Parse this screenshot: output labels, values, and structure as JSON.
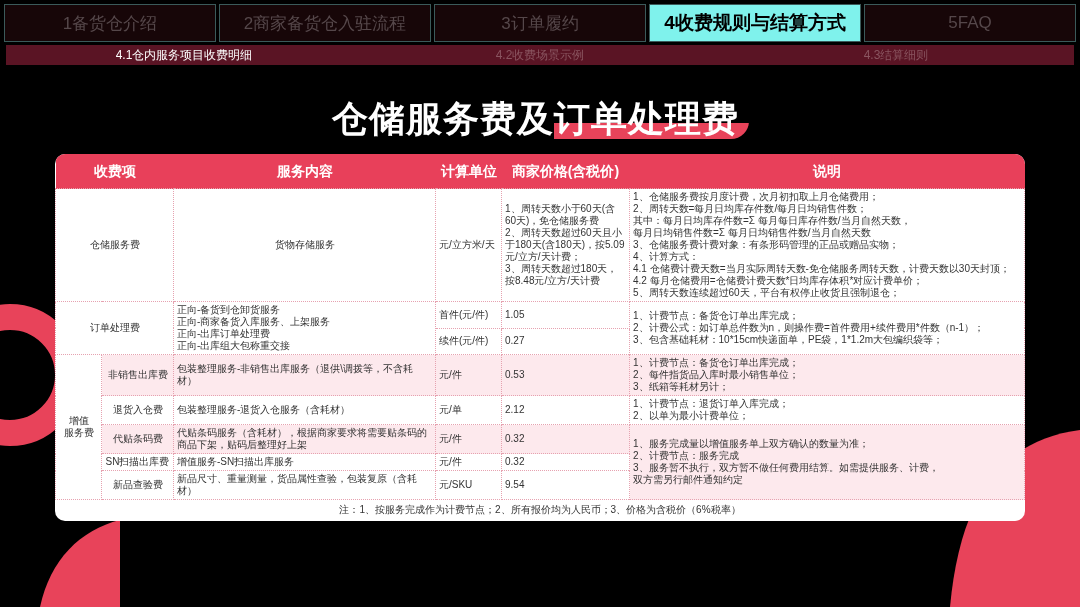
{
  "tabs": [
    {
      "label": "1备货仓介绍",
      "selected": false
    },
    {
      "label": "2商家备货仓入驻流程",
      "selected": false
    },
    {
      "label": "3订单履约",
      "selected": false
    },
    {
      "label": "4收费规则与结算方式",
      "selected": true
    },
    {
      "label": "5FAQ",
      "selected": false
    }
  ],
  "subtabs": [
    {
      "label": "4.1仓内服务项目收费明细",
      "selected": true
    },
    {
      "label": "4.2收费场景示例",
      "selected": false
    },
    {
      "label": "4.3结算细则",
      "selected": false
    }
  ],
  "title_parts": [
    {
      "text": "仓储服务费及",
      "highlighted": false
    },
    {
      "text": "订单处理费",
      "highlighted": true
    }
  ],
  "table": {
    "columns": [
      "收费项",
      "服务内容",
      "计算单位",
      "商家价格(含税价)",
      "说明"
    ],
    "groups": [
      {
        "name": [
          "仓储服务费"
        ],
        "items": [
          {
            "shaded": false,
            "service": [
              "货物存储服务"
            ],
            "prices": [
              {
                "unit": "元/立方米/天",
                "price": [
                  "1、周转天数小于60天(含60天)，免仓储服务费",
                  "2、周转天数超过60天且小于180天(含180天)，按5.09元/立方/天计费；",
                  "3、周转天数超过180天，按8.48元/立方/天计费"
                ]
              }
            ],
            "notes": [
              "1、仓储服务费按月度计费，次月初扣取上月仓储费用；",
              "2、周转天数=每月日均库存件数/每月日均销售件数；",
              "其中：每月日均库存件数=Σ 每月每日库存件数/当月自然天数，",
              "每月日均销售件数=Σ 每月日均销售件数/当月自然天数",
              "3、仓储服务费计费对象：有条形码管理的正品或赠品实物；",
              "4、计算方式：",
              "4.1 仓储费计费天数=当月实际周转天数-免仓储服务周转天数，计费天数以30天封顶；",
              "4.2 每月仓储费用=仓储费计费天数*日均库存体积*对应计费单价；",
              "5、周转天数连续超过60天，平台有权停止收货且强制退仓；"
            ]
          }
        ]
      },
      {
        "name": [
          "订单处理费"
        ],
        "items": [
          {
            "shaded": false,
            "service": [
              "正向-备货到仓卸货服务",
              "正向-商家备货入库服务、上架服务",
              "正向-出库订单处理费",
              "正向-出库组大包称重交接"
            ],
            "prices": [
              {
                "unit": "首件(元/件)",
                "price": [
                  "1.05"
                ]
              },
              {
                "unit": "续件(元/件)",
                "price": [
                  "0.27"
                ]
              }
            ],
            "notes": [
              "1、计费节点：备货仓订单出库完成；",
              "2、计费公式：如订单总件数为n，则操作费=首件费用+续件费用*件数（n-1）；",
              "3、包含基础耗材：10*15cm快递面单，PE袋，1*1.2m大包编织袋等；"
            ]
          }
        ]
      },
      {
        "name": [
          "增值",
          "服务费"
        ],
        "items": [
          {
            "name": "非销售出库费",
            "shaded": true,
            "service": [
              "包装整理服务-非销售出库服务（退供\\调拨等，不含耗材）"
            ],
            "prices": [
              {
                "unit": "元/件",
                "price": [
                  "0.53"
                ]
              }
            ],
            "notes": [
              "1、计费节点：备货仓订单出库完成；",
              "2、每件指货品入库时最小销售单位；",
              "3、纸箱等耗材另计；"
            ]
          },
          {
            "name": "退货入仓费",
            "shaded": false,
            "service": [
              "包装整理服务-退货入仓服务（含耗材）"
            ],
            "prices": [
              {
                "unit": "元/单",
                "price": [
                  "2.12"
                ]
              }
            ],
            "notes": [
              "1、计费节点：退货订单入库完成；",
              "2、以单为最小计费单位；"
            ]
          },
          {
            "name": "代贴条码费",
            "shaded": true,
            "service": [
              "代贴条码服务（含耗材），根据商家要求将需要贴条码的商品下架，贴码后整理好上架"
            ],
            "prices": [
              {
                "unit": "元/件",
                "price": [
                  "0.32"
                ]
              }
            ],
            "notes": [
              "1、服务完成量以增值服务单上双方确认的数量为准；",
              "2、计费节点：服务完成",
              "3、服务暂不执行，双方暂不做任何费用结算。如需提供服务、计费，",
              "双方需另行邮件通知约定"
            ]
          },
          {
            "name": "SN扫描出库费",
            "shaded": false,
            "service": [
              "增值服务-SN扫描出库服务"
            ],
            "prices": [
              {
                "unit": "元/件",
                "price": [
                  "0.32"
                ]
              }
            ]
          },
          {
            "name": "新品查验费",
            "shaded": false,
            "service": [
              "新品尺寸、重量测量，货品属性查验，包装复原（含耗材）"
            ],
            "prices": [
              {
                "unit": "元/SKU",
                "price": [
                  "9.54"
                ]
              }
            ]
          }
        ]
      }
    ],
    "footnote": "注：1、按服务完成作为计费节点；2、所有报价均为人民币；3、价格为含税价（6%税率）"
  }
}
